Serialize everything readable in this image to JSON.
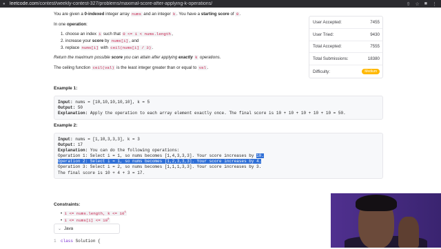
{
  "browser": {
    "url_prefix": "leetcode.com",
    "url_path": "/contest/weekly-contest-327/problems/maximal-score-after-applying-k-operations/"
  },
  "problem": {
    "intro_1": "You are given a ",
    "intro_2": "0-indexed",
    "intro_3": " integer array ",
    "intro_4": "nums",
    "intro_5": " and an integer ",
    "intro_6": "k",
    "intro_7": ". You have a ",
    "intro_8": "starting score",
    "intro_9": " of ",
    "intro_10": "0",
    "intro_11": ".",
    "op_line_1": "In one ",
    "op_line_2": "operation",
    "op_line_3": ":",
    "steps": [
      {
        "a": "1. choose an index ",
        "b": "i",
        "c": " such that ",
        "d": "0 <= i < nums.length",
        "e": ","
      },
      {
        "a": "2. increase your ",
        "b": "score",
        "c": " by ",
        "d": "nums[i]",
        "e": ", and"
      },
      {
        "a": "3. replace ",
        "b": "nums[i]",
        "c": " with ",
        "d": "ceil(nums[i] / 3)",
        "e": "."
      }
    ],
    "return_1": "Return the maximum possible ",
    "return_2": "score",
    "return_3": " you can attain after applying ",
    "return_4": "exactly",
    "return_5": " ",
    "return_6": "k",
    "return_7": " operations.",
    "ceil_1": "The ceiling function ",
    "ceil_2": "ceil(val)",
    "ceil_3": " is the least integer greater than or equal to ",
    "ceil_4": "val",
    "ceil_5": "."
  },
  "example1": {
    "title": "Example 1:",
    "input_label": "Input:",
    "input": " nums = [10,10,10,10,10], k = 5",
    "output_label": "Output:",
    "output": " 50",
    "expl_label": "Explanation:",
    "expl": " Apply the operation to each array element exactly once. The final score is 10 + 10 + 10 + 10 + 10 = 50."
  },
  "example2": {
    "title": "Example 2:",
    "input_label": "Input:",
    "input": " nums = [1,10,3,3,3], k = 3",
    "output_label": "Output:",
    "output": " 17",
    "expl_label": "Explanation:",
    "expl": " You can do the following operations:",
    "op1_a": "Operation 1: Select i = 1, so nums becomes [1,",
    "op1_b": "4",
    "op1_c": ",3,3,3]. Your score increases by ",
    "op1_d": "10.",
    "op2_a": "Operation 2: Select i = 1, so nums becomes [1,",
    "op2_b": "2",
    "op2_c": ",3,3,3]. Your score increases by 4.",
    "op3_a": "Operation 3: Select i = 2, so nums becomes [1,1,",
    "op3_b": "1",
    "op3_c": ",3,3]. Your score increases by 3.",
    "final": "The final score is 10 + 4 + 3 = 17."
  },
  "constraints": {
    "title": "Constraints:",
    "c1_a": "1 <= nums.length, k <= 10",
    "c1_sup": "5",
    "c2_a": "1 <= nums[i] <= 10",
    "c2_sup": "9"
  },
  "stats": [
    {
      "label": "User Accepted:",
      "value": "7455"
    },
    {
      "label": "User Tried:",
      "value": "9430"
    },
    {
      "label": "Total Accepted:",
      "value": "7555"
    },
    {
      "label": "Total Submissions:",
      "value": "18380"
    },
    {
      "label": "Difficulty:",
      "value": "Medium"
    }
  ],
  "editor": {
    "language": "Java",
    "line_no": "1",
    "kw": "class",
    "rest": " Solution {"
  },
  "colors": {
    "highlight": "#2f6fd6",
    "difficulty_badge": "#ffb800",
    "code_text": "#c7254e"
  }
}
